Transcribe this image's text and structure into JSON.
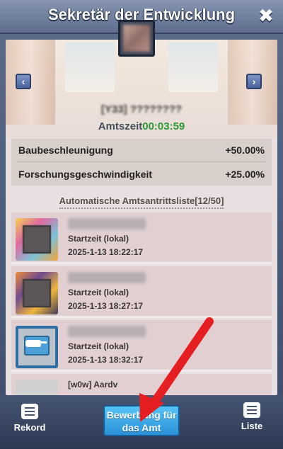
{
  "header": {
    "title": "Sekretär der Entwicklung",
    "close_icon": "close-icon"
  },
  "profile": {
    "name": "[Y33] ????????",
    "term_label": "Amtszeit",
    "term_value": "00:03:59"
  },
  "stats": [
    {
      "label": "Baubeschleunigung",
      "value": "+50.00%"
    },
    {
      "label": "Forschungsgeschwindigkeit",
      "value": "+25.00%"
    }
  ],
  "list": {
    "title": "Automatische Amtsantrittsliste[12/50]",
    "items": [
      {
        "label": "Startzeit (lokal)",
        "date": "2025-1-13 18:22:17"
      },
      {
        "label": "Startzeit (lokal)",
        "date": "2025-1-13 18:27:17"
      },
      {
        "label": "Startzeit (lokal)",
        "date": "2025-1-13 18:32:17"
      },
      {
        "name_partial": "[w0w] Aardv",
        "label": "",
        "date": ""
      }
    ]
  },
  "footer": {
    "record_label": "Rekord",
    "apply_label": "Bewerbung für das Amt",
    "list_label": "Liste"
  },
  "colors": {
    "accent_green": "#2c9a37",
    "button_blue": "#2a91d8"
  }
}
